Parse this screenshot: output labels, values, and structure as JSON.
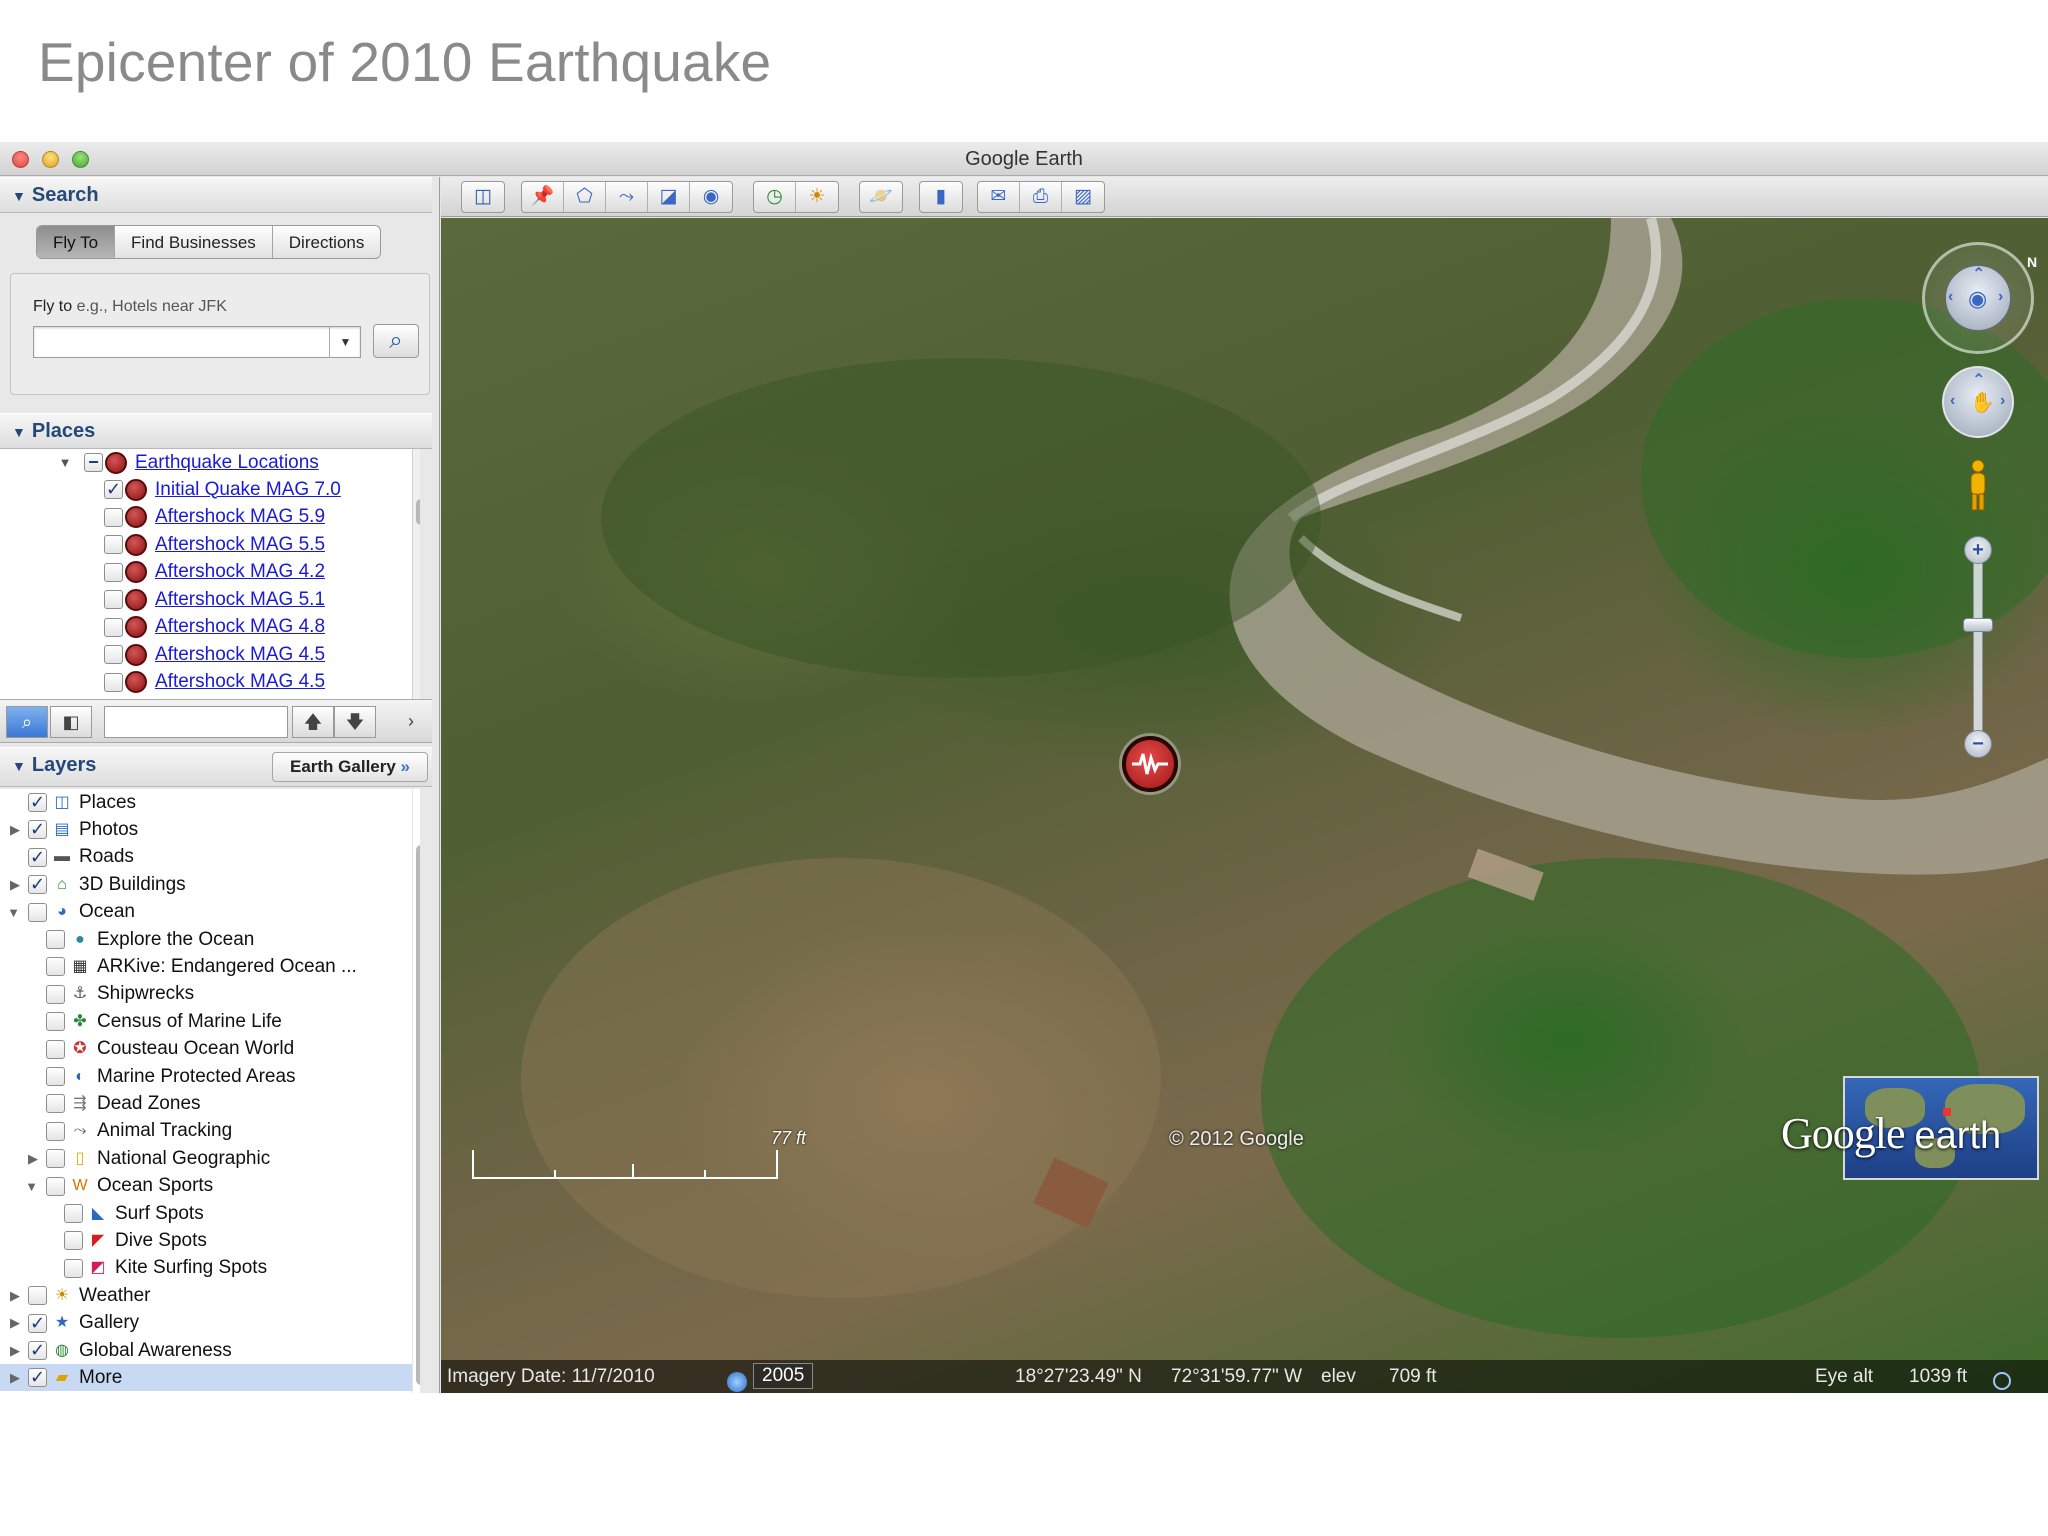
{
  "slide": {
    "title": "Epicenter of 2010 Earthquake"
  },
  "window": {
    "title": "Google Earth"
  },
  "search": {
    "header": "Search",
    "tabs": [
      "Fly To",
      "Find Businesses",
      "Directions"
    ],
    "active_tab": "Fly To",
    "flyto_label": "Fly to",
    "flyto_placeholder": "e.g., Hotels near JFK",
    "input_value": ""
  },
  "places": {
    "header": "Places",
    "folder": "Earthquake Locations",
    "items": [
      {
        "label": "Initial Quake MAG 7.0",
        "checked": true
      },
      {
        "label": "Aftershock MAG 5.9",
        "checked": false
      },
      {
        "label": "Aftershock MAG 5.5",
        "checked": false
      },
      {
        "label": "Aftershock MAG 4.2",
        "checked": false
      },
      {
        "label": "Aftershock MAG 5.1",
        "checked": false
      },
      {
        "label": "Aftershock MAG 4.8",
        "checked": false
      },
      {
        "label": "Aftershock MAG 4.5",
        "checked": false
      },
      {
        "label": "Aftershock MAG 4.5",
        "checked": false
      }
    ]
  },
  "layers": {
    "header": "Layers",
    "earth_gallery": "Earth Gallery",
    "earth_gallery_chevron": "»",
    "items": [
      {
        "label": "Places",
        "checked": true,
        "icon": "places-icon",
        "glyph": "◫"
      },
      {
        "label": "Photos",
        "checked": true,
        "icon": "photos-icon",
        "glyph": "▤"
      },
      {
        "label": "Roads",
        "checked": true,
        "icon": "roads-icon",
        "glyph": "▬"
      },
      {
        "label": "3D Buildings",
        "checked": true,
        "icon": "buildings-icon",
        "glyph": "⌂"
      },
      {
        "label": "Ocean",
        "checked": false,
        "icon": "ocean-icon",
        "glyph": "◕"
      },
      {
        "label": "Explore the Ocean",
        "checked": false,
        "icon": "explore-ocean-icon",
        "glyph": "●"
      },
      {
        "label": "ARKive: Endangered Ocean ...",
        "checked": false,
        "icon": "arkive-icon",
        "glyph": "▦"
      },
      {
        "label": "Shipwrecks",
        "checked": false,
        "icon": "shipwreck-icon",
        "glyph": "⚓"
      },
      {
        "label": "Census of Marine Life",
        "checked": false,
        "icon": "marine-life-icon",
        "glyph": "✤"
      },
      {
        "label": "Cousteau Ocean World",
        "checked": false,
        "icon": "cousteau-icon",
        "glyph": "✪"
      },
      {
        "label": "Marine Protected Areas",
        "checked": false,
        "icon": "protected-areas-icon",
        "glyph": "◐"
      },
      {
        "label": "Dead Zones",
        "checked": false,
        "icon": "dead-zones-icon",
        "glyph": "⇶"
      },
      {
        "label": "Animal Tracking",
        "checked": false,
        "icon": "animal-tracking-icon",
        "glyph": "⤳"
      },
      {
        "label": "National Geographic",
        "checked": false,
        "icon": "natgeo-icon",
        "glyph": "▯"
      },
      {
        "label": "Ocean Sports",
        "checked": false,
        "icon": "ocean-sports-icon",
        "glyph": "W"
      },
      {
        "label": "Surf Spots",
        "checked": false,
        "icon": "surf-icon",
        "glyph": "◣"
      },
      {
        "label": "Dive Spots",
        "checked": false,
        "icon": "dive-icon",
        "glyph": "◤"
      },
      {
        "label": "Kite Surfing Spots",
        "checked": false,
        "icon": "kite-icon",
        "glyph": "◩"
      },
      {
        "label": "Weather",
        "checked": false,
        "icon": "weather-icon",
        "glyph": "☀"
      },
      {
        "label": "Gallery",
        "checked": true,
        "icon": "gallery-icon",
        "glyph": "★"
      },
      {
        "label": "Global Awareness",
        "checked": true,
        "icon": "global-awareness-icon",
        "glyph": "◍"
      },
      {
        "label": "More",
        "checked": true,
        "icon": "more-icon",
        "glyph": "▰"
      }
    ]
  },
  "map": {
    "scale_label": "77 ft",
    "copyright": "© 2012 Google",
    "logo_google": "Google",
    "logo_earth": "earth",
    "compass_north": "N"
  },
  "status": {
    "imagery_date": "Imagery Date: 11/7/2010",
    "year": "2005",
    "lat": "18°27'23.49\" N",
    "lon": "72°31'59.77\" W",
    "elev_label": "elev",
    "elev": "709 ft",
    "eye_alt_label": "Eye alt",
    "eye_alt": "1039 ft"
  },
  "colors": {
    "link": "#1a1ad6",
    "header_text": "#24487a",
    "selected_row": "#c8daf3"
  }
}
